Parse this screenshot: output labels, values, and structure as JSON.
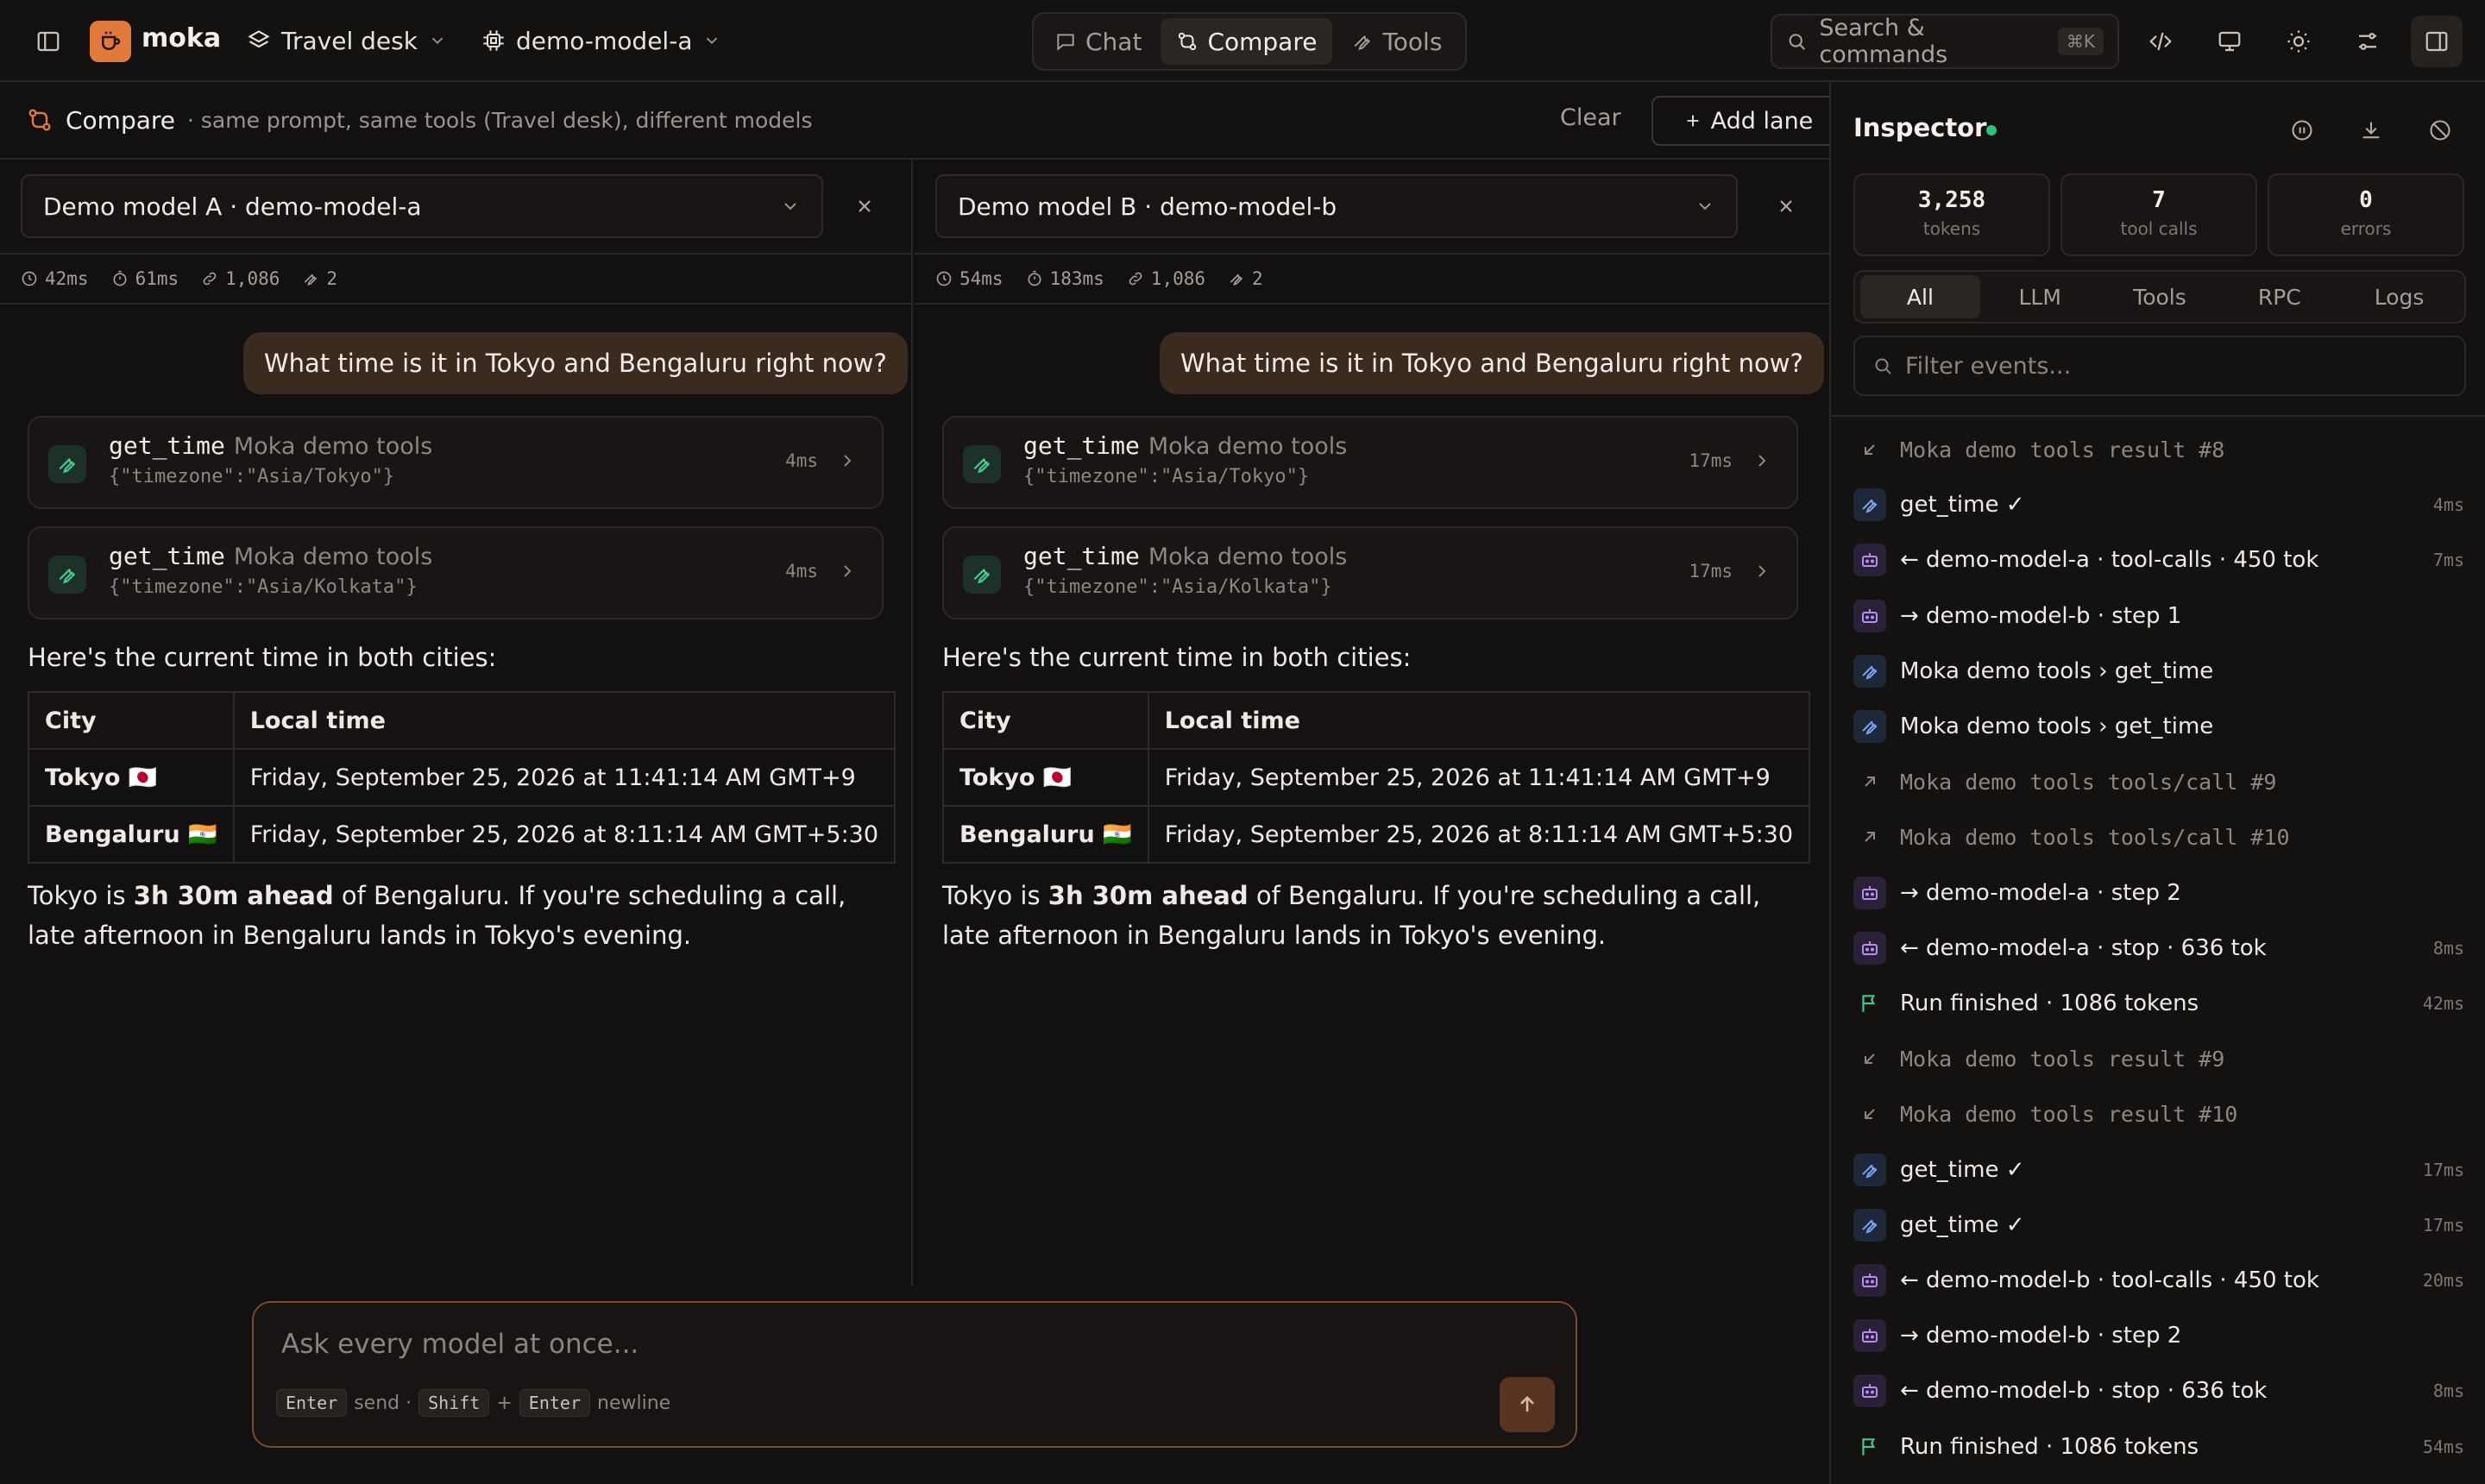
{
  "app": {
    "name": "moka"
  },
  "topbar": {
    "workspace": "Travel desk",
    "model": "demo-model-a",
    "tabs": [
      {
        "label": "Chat",
        "icon": "chat-bubble-icon"
      },
      {
        "label": "Compare",
        "icon": "compare-icon"
      },
      {
        "label": "Tools",
        "icon": "wrench-icon"
      }
    ],
    "active_tab": "Compare",
    "search": {
      "placeholder": "Search & commands",
      "shortcut": "⌘K"
    }
  },
  "compare": {
    "title": "Compare",
    "subtitle": "· same prompt, same tools (Travel desk), different models",
    "clear_label": "Clear",
    "add_lane_label": "Add lane"
  },
  "lanes": [
    {
      "model_label": "Demo model A · demo-model-a",
      "stats": {
        "latency": "42ms",
        "ttft": "61ms",
        "tokens": "1,086",
        "tool_calls": "2"
      },
      "user_message": "What time is it in Tokyo and Bengaluru right now?",
      "tool_calls": [
        {
          "name": "get_time",
          "source": "Moka demo tools",
          "args": "{\"timezone\":\"Asia/Tokyo\"}",
          "duration": "4ms"
        },
        {
          "name": "get_time",
          "source": "Moka demo tools",
          "args": "{\"timezone\":\"Asia/Kolkata\"}",
          "duration": "4ms"
        }
      ],
      "answer_intro": "Here's the current time in both cities:",
      "table": {
        "headers": [
          "City",
          "Local time"
        ],
        "rows": [
          {
            "city": "Tokyo 🇯🇵",
            "time": "Friday, September 25, 2026 at 11:41:14 AM GMT+9"
          },
          {
            "city": "Bengaluru 🇮🇳",
            "time": "Friday, September 25, 2026 at 8:11:14 AM GMT+5:30"
          }
        ]
      },
      "answer_outro": {
        "pre": "Tokyo is ",
        "bold": "3h 30m ahead",
        "post": " of Bengaluru. If you're scheduling a call, late afternoon in Bengaluru lands in Tokyo's evening."
      }
    },
    {
      "model_label": "Demo model B · demo-model-b",
      "stats": {
        "latency": "54ms",
        "ttft": "183ms",
        "tokens": "1,086",
        "tool_calls": "2"
      },
      "user_message": "What time is it in Tokyo and Bengaluru right now?",
      "tool_calls": [
        {
          "name": "get_time",
          "source": "Moka demo tools",
          "args": "{\"timezone\":\"Asia/Tokyo\"}",
          "duration": "17ms"
        },
        {
          "name": "get_time",
          "source": "Moka demo tools",
          "args": "{\"timezone\":\"Asia/Kolkata\"}",
          "duration": "17ms"
        }
      ],
      "answer_intro": "Here's the current time in both cities:",
      "table": {
        "headers": [
          "City",
          "Local time"
        ],
        "rows": [
          {
            "city": "Tokyo 🇯🇵",
            "time": "Friday, September 25, 2026 at 11:41:14 AM GMT+9"
          },
          {
            "city": "Bengaluru 🇮🇳",
            "time": "Friday, September 25, 2026 at 8:11:14 AM GMT+5:30"
          }
        ]
      },
      "answer_outro": {
        "pre": "Tokyo is ",
        "bold": "3h 30m ahead",
        "post": " of Bengaluru. If you're scheduling a call, late afternoon in Bengaluru lands in Tokyo's evening."
      }
    }
  ],
  "composer": {
    "placeholder": "Ask every model at once...",
    "key_enter": "Enter",
    "send_text": "send ·",
    "key_shift": "Shift",
    "plus": "+",
    "newline_text": "newline"
  },
  "inspector": {
    "title": "Inspector",
    "metrics": [
      {
        "value": "3,258",
        "label": "tokens"
      },
      {
        "value": "7",
        "label": "tool calls"
      },
      {
        "value": "0",
        "label": "errors"
      }
    ],
    "filter_tabs": [
      "All",
      "LLM",
      "Tools",
      "RPC",
      "Logs"
    ],
    "active_filter": "All",
    "filter_placeholder": "Filter events...",
    "events": [
      {
        "kind": "result",
        "text": "Moka demo tools result #8",
        "ms": ""
      },
      {
        "kind": "tool",
        "text": "get_time ✓",
        "ms": "4ms"
      },
      {
        "kind": "model",
        "text": "← demo-model-a · tool-calls · 450 tok",
        "ms": "7ms"
      },
      {
        "kind": "model",
        "text": "→ demo-model-b · step 1",
        "ms": ""
      },
      {
        "kind": "tool",
        "text": "Moka demo tools › get_time",
        "ms": ""
      },
      {
        "kind": "tool",
        "text": "Moka demo tools › get_time",
        "ms": ""
      },
      {
        "kind": "call",
        "text": "Moka demo tools tools/call #9",
        "ms": ""
      },
      {
        "kind": "call",
        "text": "Moka demo tools tools/call #10",
        "ms": ""
      },
      {
        "kind": "model",
        "text": "→ demo-model-a · step 2",
        "ms": ""
      },
      {
        "kind": "model",
        "text": "← demo-model-a · stop · 636 tok",
        "ms": "8ms"
      },
      {
        "kind": "flag",
        "text": "Run finished · 1086 tokens",
        "ms": "42ms"
      },
      {
        "kind": "result",
        "text": "Moka demo tools result #9",
        "ms": ""
      },
      {
        "kind": "result",
        "text": "Moka demo tools result #10",
        "ms": ""
      },
      {
        "kind": "tool",
        "text": "get_time ✓",
        "ms": "17ms"
      },
      {
        "kind": "tool",
        "text": "get_time ✓",
        "ms": "17ms"
      },
      {
        "kind": "model",
        "text": "← demo-model-b · tool-calls · 450 tok",
        "ms": "20ms"
      },
      {
        "kind": "model",
        "text": "→ demo-model-b · step 2",
        "ms": ""
      },
      {
        "kind": "model",
        "text": "← demo-model-b · stop · 636 tok",
        "ms": "8ms"
      },
      {
        "kind": "flag",
        "text": "Run finished · 1086 tokens",
        "ms": "54ms"
      }
    ]
  },
  "colors": {
    "accent": "#e07a3c",
    "live": "#2ec27e",
    "user_bubble": "#3a2a20",
    "tool_green": "#3fcf8e"
  }
}
